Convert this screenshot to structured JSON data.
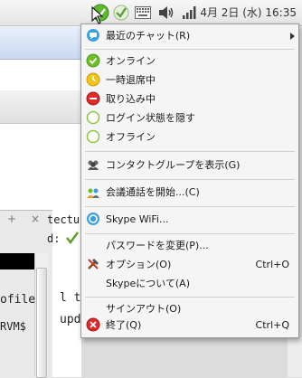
{
  "panel": {
    "clock": "4月 2日 (水) 16:35",
    "tray_icons": [
      "skype-status-icon",
      "checkmark-icon",
      "keyboard-icon",
      "volume-icon",
      "signal-icon"
    ]
  },
  "background": {
    "text_lines": [
      "tectur",
      "d:",
      "ofile",
      "l the",
      "upda",
      "RVM$"
    ],
    "tab_symbols": [
      "+",
      "×"
    ]
  },
  "menu": {
    "recent_chats": "最近のチャット(R)",
    "online": "オンライン",
    "away": "一時退席中",
    "busy": "取り込み中",
    "invisible": "ログイン状態を隠す",
    "offline": "オフライン",
    "show_groups": "コンタクトグループを表示(G)",
    "start_conference": "会議通話を開始...(C)",
    "skype_wifi": "Skype WiFi...",
    "change_password": "パスワードを変更(P)...",
    "options": "オプション(O)",
    "options_shortcut": "Ctrl+O",
    "about": "Skypeについて(A)",
    "sign_out": "サインアウト(O)",
    "quit": "終了(Q)",
    "quit_shortcut": "Ctrl+Q"
  },
  "colors": {
    "online": "#6cbf2a",
    "away": "#f2c318",
    "busy": "#dd2b2b",
    "offline_ring": "#8cc63f",
    "chat_blue": "#3aa0e0"
  }
}
